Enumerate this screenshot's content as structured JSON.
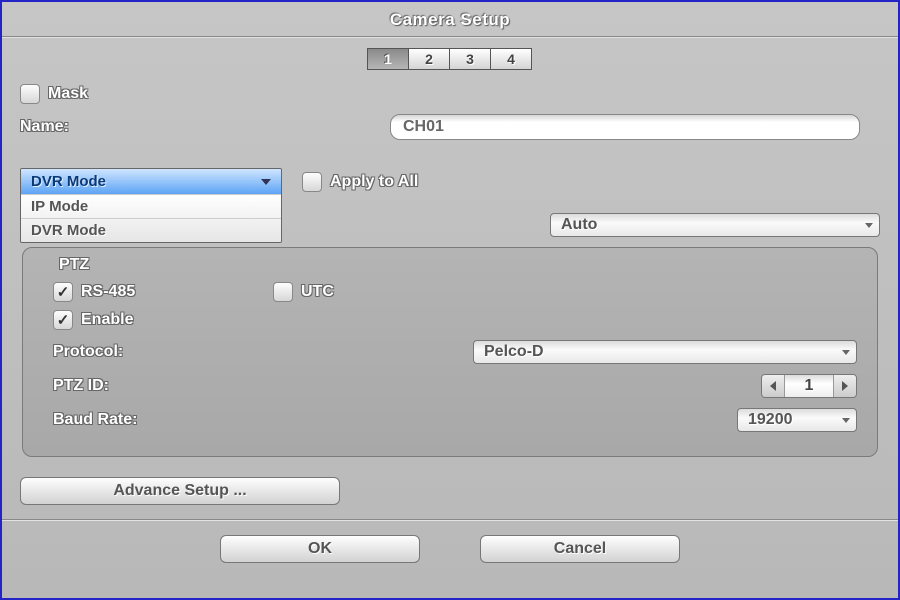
{
  "title": "Camera Setup",
  "tabs": [
    "1",
    "2",
    "3",
    "4"
  ],
  "active_tab": 0,
  "mask": {
    "label": "Mask",
    "checked": false
  },
  "name": {
    "label": "Name:",
    "value": "CH01"
  },
  "mode_dropdown": {
    "selected": "DVR Mode",
    "options": [
      "IP Mode",
      "DVR Mode"
    ]
  },
  "apply_all": {
    "label": "Apply to All",
    "checked": false
  },
  "auto_select": {
    "value": "Auto"
  },
  "ptz": {
    "title": "PTZ",
    "rs485": {
      "label": "RS-485",
      "checked": true
    },
    "utc": {
      "label": "UTC",
      "checked": false
    },
    "enable": {
      "label": "Enable",
      "checked": true
    },
    "protocol": {
      "label": "Protocol:",
      "value": "Pelco-D"
    },
    "ptz_id": {
      "label": "PTZ ID:",
      "value": "1"
    },
    "baud": {
      "label": "Baud Rate:",
      "value": "19200"
    }
  },
  "advance_label": "Advance Setup ...",
  "ok_label": "OK",
  "cancel_label": "Cancel"
}
